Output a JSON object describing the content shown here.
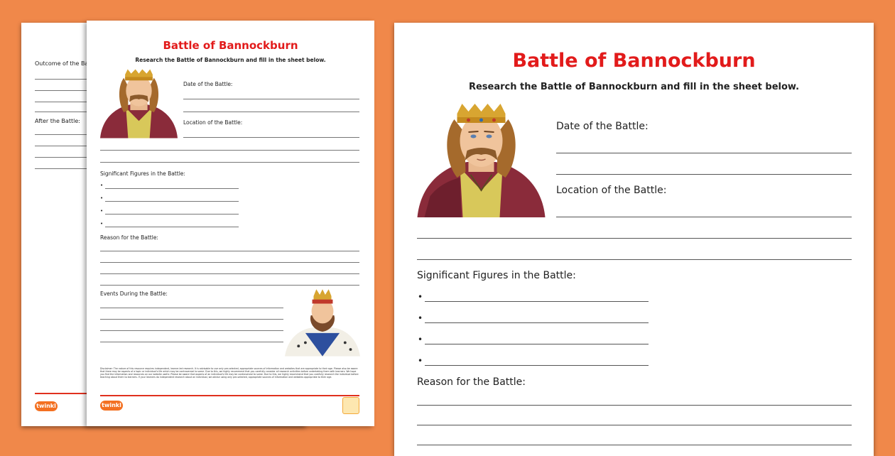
{
  "worksheet": {
    "title": "Battle of Bannockburn",
    "instructions": "Research the Battle of Bannockburn and fill in the sheet below.",
    "labels": {
      "date": "Date of the Battle:",
      "location": "Location of the Battle:",
      "figures": "Significant Figures in the Battle:",
      "reason": "Reason for the Battle:",
      "events": "Events During the Battle:",
      "outcome": "Outcome of the Battle:",
      "after": "After the Battle:"
    },
    "bullet": "•",
    "disclaimer": "Disclaimer: The nature of this resource requires independent, learner-led research. It is advisable to use only pre-selected, appropriate sources of information and websites that are appropriate to their age. Please also be aware that there may be aspects of a topic or individual's life which may be controversial to some. Due to this, we highly recommend that you carefully consider all research activities before undertaking them with learners. We hope you find the information and resources on our website useful. Please be aware that aspects of an individual's life may be controversial to some. Due to this, we highly recommend that you carefully research the individual before teaching about them to learners. If your learners do independent research about an individual, we advise using only pre-selected, appropriate sources of information and websites appropriate to their age.",
    "brand": "twinkl"
  },
  "colors": {
    "background": "#f0884a",
    "title_red": "#e21b1b",
    "robe": "#8a2b3a",
    "gold": "#d8a531"
  }
}
